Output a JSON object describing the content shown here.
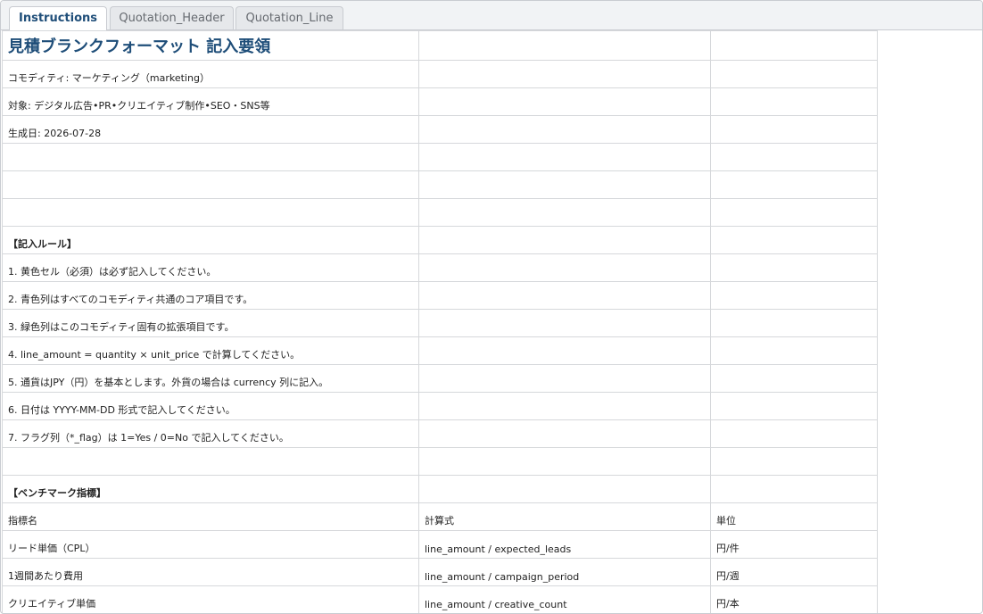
{
  "tabs": [
    {
      "label": "Instructions",
      "active": true
    },
    {
      "label": "Quotation_Header",
      "active": false
    },
    {
      "label": "Quotation_Line",
      "active": false
    }
  ],
  "sheet": {
    "title": "見積ブランクフォーマット 記入要領",
    "commodity": "コモディティ: マーケティング（marketing）",
    "target": "対象: デジタル広告•PR•クリエイティブ制作•SEO・SNS等",
    "generated": "生成日: 2026-07-28",
    "rules_heading": "【記入ルール】",
    "rules": [
      "1. 黄色セル（必須）は必ず記入してください。",
      "2. 青色列はすべてのコモディティ共通のコア項目です。",
      "3. 緑色列はこのコモディティ固有の拡張項目です。",
      "4. line_amount = quantity × unit_price で計算してください。",
      "5. 通貨はJPY（円）を基本とします。外貨の場合は currency 列に記入。",
      "6. 日付は YYYY-MM-DD 形式で記入してください。",
      "7. フラグ列（*_flag）は 1=Yes / 0=No で記入してください。"
    ],
    "benchmark_heading": "【ベンチマーク指標】",
    "benchmark_header": [
      "指標名",
      "計算式",
      "単位"
    ],
    "benchmarks": [
      [
        "リード単価（CPL）",
        "line_amount / expected_leads",
        "円/件"
      ],
      [
        "1週間あたり費用",
        "line_amount / campaign_period",
        "円/週"
      ],
      [
        "クリエイティブ単価",
        "line_amount / creative_count",
        "円/本"
      ]
    ]
  }
}
